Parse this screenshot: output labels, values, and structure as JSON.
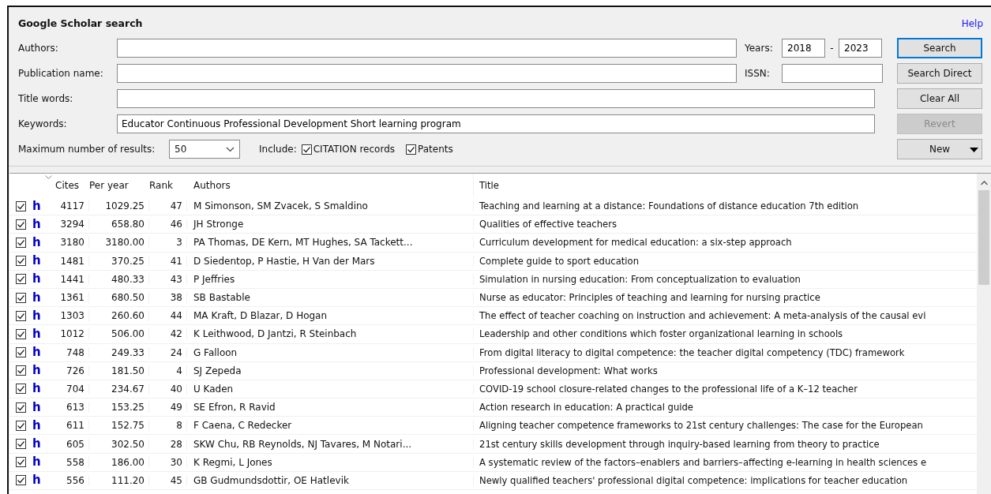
{
  "panel": {
    "title": "Google Scholar search",
    "help": "Help"
  },
  "fields": [
    {
      "label": "Authors:"
    },
    {
      "label": "Publication name:"
    },
    {
      "label": "Title words:"
    },
    {
      "label": "Keywords:",
      "value": "Educator Continuous Professional Development Short learning program"
    }
  ],
  "years": {
    "label": "Years:",
    "from": "2018",
    "separator": "-",
    "to": "2023"
  },
  "issn": {
    "label": "ISSN:"
  },
  "max_results": {
    "label": "Maximum number of results:",
    "value": "50"
  },
  "include": {
    "label": "Include:",
    "options": [
      {
        "label": "CITATION records",
        "checked": true
      },
      {
        "label": "Patents",
        "checked": true
      }
    ]
  },
  "buttons": [
    {
      "label": "Search",
      "disabled": false,
      "focused": true,
      "dropdown": false
    },
    {
      "label": "Search Direct",
      "disabled": false,
      "focused": false,
      "dropdown": false
    },
    {
      "label": "Clear All",
      "disabled": false,
      "focused": false,
      "dropdown": false
    },
    {
      "label": "Revert",
      "disabled": true,
      "focused": false,
      "dropdown": false
    },
    {
      "label": "New",
      "disabled": false,
      "focused": false,
      "dropdown": true
    }
  ],
  "table": {
    "columns": [
      "Cites",
      "Per year",
      "Rank",
      "Authors",
      "Title"
    ],
    "rows": [
      {
        "checked": true,
        "link": "h",
        "cites": "4117",
        "per_year": "1029.25",
        "rank": "47",
        "authors": "M Simonson, SM Zvacek, S Smaldino",
        "title": "Teaching and learning at a distance: Foundations of distance education 7th edition"
      },
      {
        "checked": true,
        "link": "h",
        "cites": "3294",
        "per_year": "658.80",
        "rank": "46",
        "authors": "JH Stronge",
        "title": "Qualities of effective teachers"
      },
      {
        "checked": true,
        "link": "h",
        "cites": "3180",
        "per_year": "3180.00",
        "rank": "3",
        "authors": "PA Thomas, DE Kern, MT Hughes, SA Tackett...",
        "title": "Curriculum development for medical education: a six-step approach"
      },
      {
        "checked": true,
        "link": "h",
        "cites": "1481",
        "per_year": "370.25",
        "rank": "41",
        "authors": "D Siedentop, P Hastie, H Van der Mars",
        "title": "Complete guide to sport education"
      },
      {
        "checked": true,
        "link": "h",
        "cites": "1441",
        "per_year": "480.33",
        "rank": "43",
        "authors": "P Jeffries",
        "title": "Simulation in nursing education: From conceptualization to evaluation"
      },
      {
        "checked": true,
        "link": "h",
        "cites": "1361",
        "per_year": "680.50",
        "rank": "38",
        "authors": "SB Bastable",
        "title": "Nurse as educator: Principles of teaching and learning for nursing practice"
      },
      {
        "checked": true,
        "link": "h",
        "cites": "1303",
        "per_year": "260.60",
        "rank": "44",
        "authors": "MA Kraft, D Blazar, D Hogan",
        "title": "The effect of teacher coaching on instruction and achievement: A meta-analysis of the causal evi"
      },
      {
        "checked": true,
        "link": "h",
        "cites": "1012",
        "per_year": "506.00",
        "rank": "42",
        "authors": "K Leithwood, D Jantzi, R Steinbach",
        "title": "Leadership and other conditions which foster organizational learning in schools"
      },
      {
        "checked": true,
        "link": "h",
        "cites": "748",
        "per_year": "249.33",
        "rank": "24",
        "authors": "G Falloon",
        "title": "From digital literacy to digital competence: the teacher digital competency (TDC) framework"
      },
      {
        "checked": true,
        "link": "h",
        "cites": "726",
        "per_year": "181.50",
        "rank": "4",
        "authors": "SJ Zepeda",
        "title": "Professional development: What works"
      },
      {
        "checked": true,
        "link": "h",
        "cites": "704",
        "per_year": "234.67",
        "rank": "40",
        "authors": "U Kaden",
        "title": "COVID-19 school closure-related changes to the professional life of a K–12 teacher"
      },
      {
        "checked": true,
        "link": "h",
        "cites": "613",
        "per_year": "153.25",
        "rank": "49",
        "authors": "SE Efron, R Ravid",
        "title": "Action research in education: A practical guide"
      },
      {
        "checked": true,
        "link": "h",
        "cites": "611",
        "per_year": "152.75",
        "rank": "8",
        "authors": "F Caena, C Redecker",
        "title": "Aligning teacher competence frameworks to 21st century challenges: The case for the European"
      },
      {
        "checked": true,
        "link": "h",
        "cites": "605",
        "per_year": "302.50",
        "rank": "28",
        "authors": "SKW Chu, RB Reynolds, NJ Tavares, M Notari...",
        "title": "21st century skills development through inquiry-based learning from theory to practice"
      },
      {
        "checked": true,
        "link": "h",
        "cites": "558",
        "per_year": "186.00",
        "rank": "30",
        "authors": "K Regmi, L Jones",
        "title": "A systematic review of the factors–enablers and barriers–affecting e-learning in health sciences e"
      },
      {
        "checked": true,
        "link": "h",
        "cites": "556",
        "per_year": "111.20",
        "rank": "45",
        "authors": "GB Gudmundsdottir, OE Hatlevik",
        "title": "Newly qualified teachers' professional digital competence: implications for teacher education"
      }
    ]
  }
}
